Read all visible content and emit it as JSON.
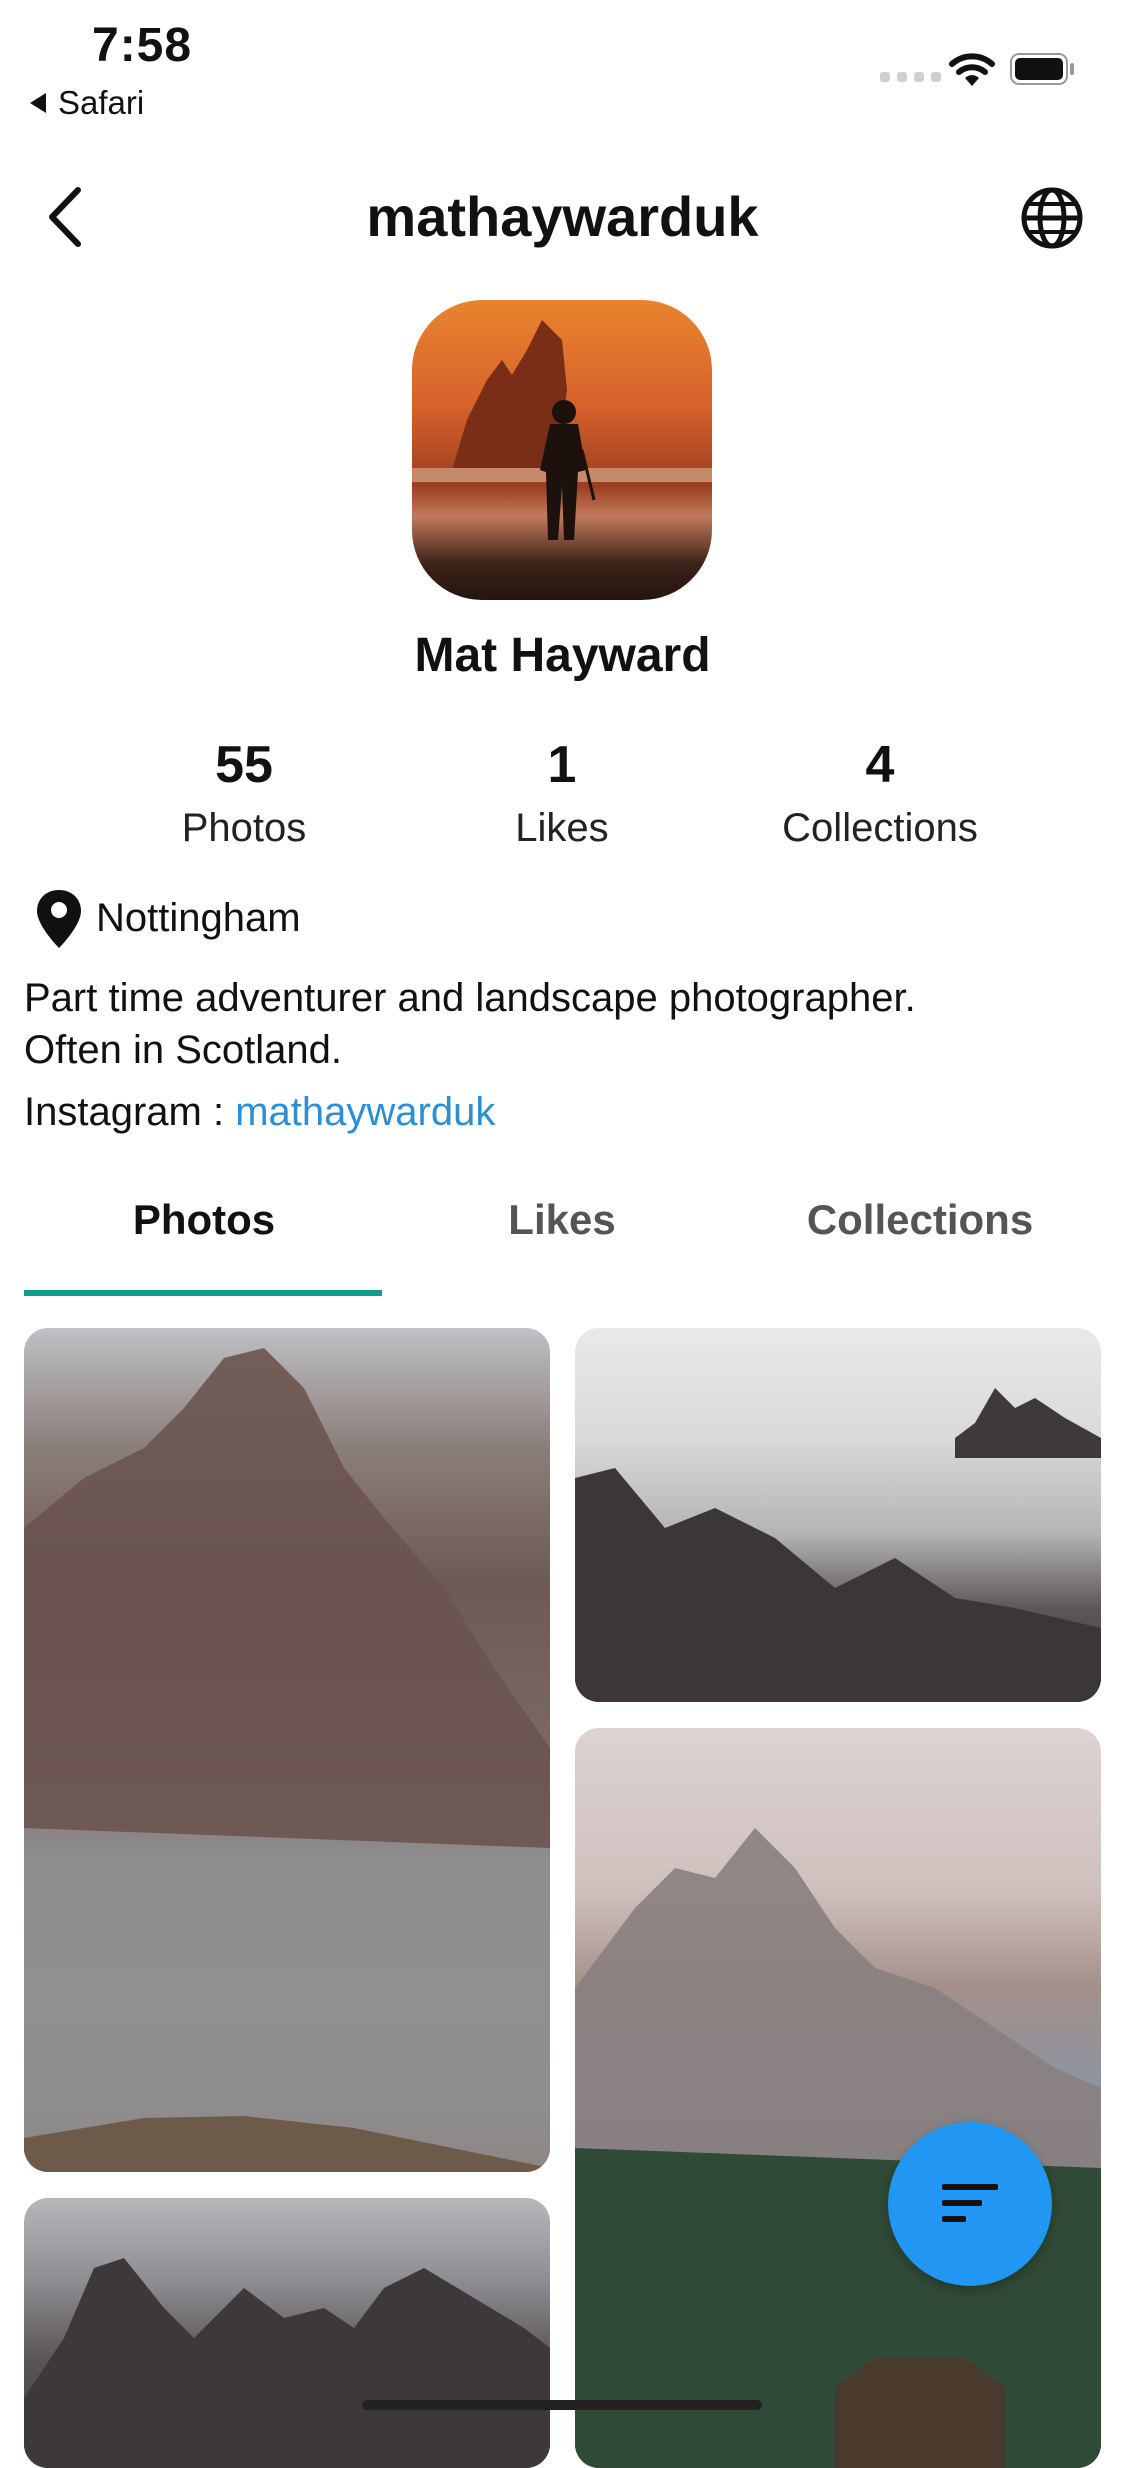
{
  "status_bar": {
    "time": "7:58",
    "back_app": "Safari"
  },
  "header": {
    "username": "mathaywarduk"
  },
  "profile": {
    "name": "Mat Hayward",
    "stats": [
      {
        "value": "55",
        "label": "Photos"
      },
      {
        "value": "1",
        "label": "Likes"
      },
      {
        "value": "4",
        "label": "Collections"
      }
    ],
    "location": "Nottingham",
    "bio_line1": "Part time adventurer and landscape photographer.",
    "bio_line2": "Often in Scotland.",
    "instagram_label": "Instagram : ",
    "instagram_handle": "mathaywarduk"
  },
  "tabs": [
    {
      "label": "Photos",
      "active": true
    },
    {
      "label": "Likes",
      "active": false
    },
    {
      "label": "Collections",
      "active": false
    }
  ],
  "colors": {
    "accent_tab": "#159a8c",
    "link": "#2b8fd6",
    "fab": "#2196f3"
  },
  "icons": [
    "back-chevron-icon",
    "globe-icon",
    "location-pin-icon",
    "sort-icon",
    "wifi-icon",
    "battery-icon"
  ]
}
